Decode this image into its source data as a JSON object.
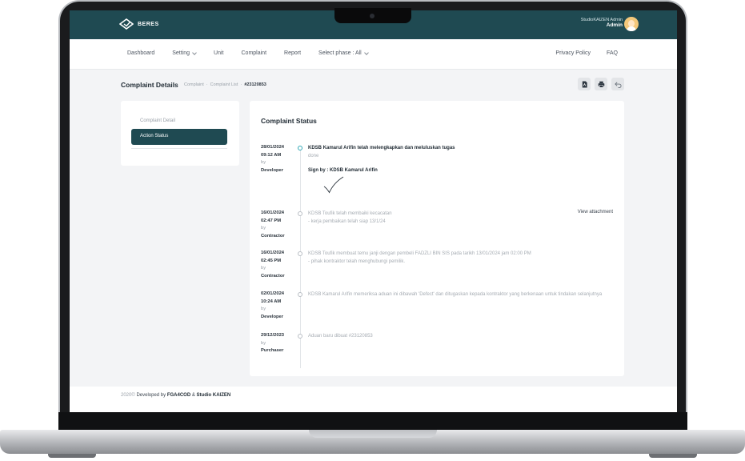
{
  "header": {
    "brand": "BERES",
    "user_name": "StudioKAIZEN Admin",
    "user_role": "Admin"
  },
  "nav": {
    "left": [
      "Dashboard",
      "Setting",
      "Unit",
      "Complaint",
      "Report",
      "Select phase : All"
    ],
    "right": [
      "Privacy Policy",
      "FAQ"
    ]
  },
  "page": {
    "title": "Complaint Details",
    "breadcrumbs": [
      "Complaint",
      "Complaint List",
      "#23120853"
    ]
  },
  "sidebar": {
    "items": [
      {
        "label": "Complaint Detail"
      },
      {
        "label": "Action Status"
      }
    ]
  },
  "status": {
    "title": "Complaint Status",
    "entries": [
      {
        "date": "28/01/2024",
        "time": "09:12 AM",
        "by_label": "by",
        "role": "Developer",
        "text": "KDSB Kamarul Arifin telah melengkapkan dan meluluskan tugas",
        "sub": "done",
        "sign_label": "Sign by : KDSB Kamarul Arifin"
      },
      {
        "date": "16/01/2024",
        "time": "02:47 PM",
        "by_label": "by",
        "role": "Contractor",
        "text": "KDSB Toufik telah membaiki kecacatan",
        "sub": "- kerja pembaikan telah siap 13/1/24",
        "link": "View attachment"
      },
      {
        "date": "16/01/2024",
        "time": "02:45 PM",
        "by_label": "by",
        "role": "Contractor",
        "text": "KDSB Toufik membuat temu janji dengan pembeli FADZLI BIN SIS pada tarikh 13/01/2024 jam 02:00 PM",
        "sub": "- pihak kontraktor telah menghubungi pemilik."
      },
      {
        "date": "02/01/2024",
        "time": "10:24 AM",
        "by_label": "by",
        "role": "Developer",
        "text": "KDSB Kamarul Arifin memeriksa aduan ini dibawah 'Defect' dan ditugaskan kepada kontraktor yang berkenaan untuk tindakan selanjutnya"
      },
      {
        "date": "29/12/2023",
        "by_label": "by",
        "role": "Purchaser",
        "text": "Aduan baru dibuat #23120853"
      }
    ]
  },
  "footer": {
    "year": "2020©",
    "developed_by": "Developed by",
    "dev1": "FGA4COD",
    "and": "&",
    "dev2": "Studio KAIZEN"
  },
  "colors": {
    "primary": "#1f4a52",
    "accent": "#2fa7b5"
  }
}
